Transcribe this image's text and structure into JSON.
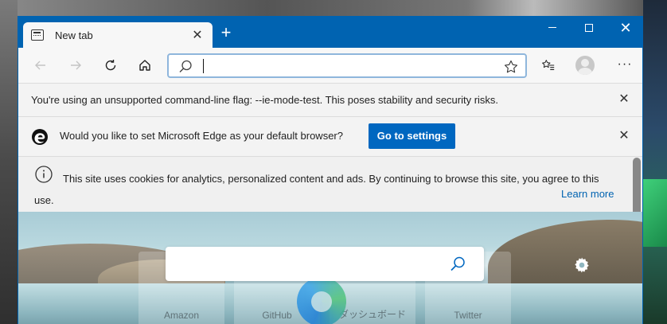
{
  "browser": {
    "tab": {
      "title": "New tab",
      "close": "✕"
    },
    "new_tab": "+",
    "window_controls": {
      "close": "✕"
    }
  },
  "toolbar": {
    "address": {
      "value": "",
      "placeholder": ""
    },
    "more": "···"
  },
  "infobars": {
    "flag_warning": {
      "message": "You're using an unsupported command-line flag: --ie-mode-test. This poses stability and security risks.",
      "close": "✕"
    },
    "default_browser": {
      "message": "Would you like to set Microsoft Edge as your default browser?",
      "button": "Go to settings",
      "close": "✕"
    },
    "cookies": {
      "message": "This site uses cookies for analytics, personalized content and ads. By continuing to browse this site, you agree to this use.",
      "link": "Learn more"
    }
  },
  "new_tab_page": {
    "search": {
      "value": "",
      "placeholder": ""
    },
    "quick_links": [
      {
        "label": "Amazon"
      },
      {
        "label": "GitHub"
      },
      {
        "label": "ダッシュボード"
      },
      {
        "label": "Twitter"
      }
    ]
  },
  "colors": {
    "titlebar": "#0063b1",
    "button": "#0067c0",
    "link": "#0063b1"
  },
  "icons": [
    "tab-page-icon",
    "back-icon",
    "forward-icon",
    "refresh-icon",
    "home-icon",
    "search-icon",
    "star-icon",
    "favorites-icon",
    "profile-icon",
    "edge-logo-icon",
    "info-icon",
    "gear-icon"
  ]
}
